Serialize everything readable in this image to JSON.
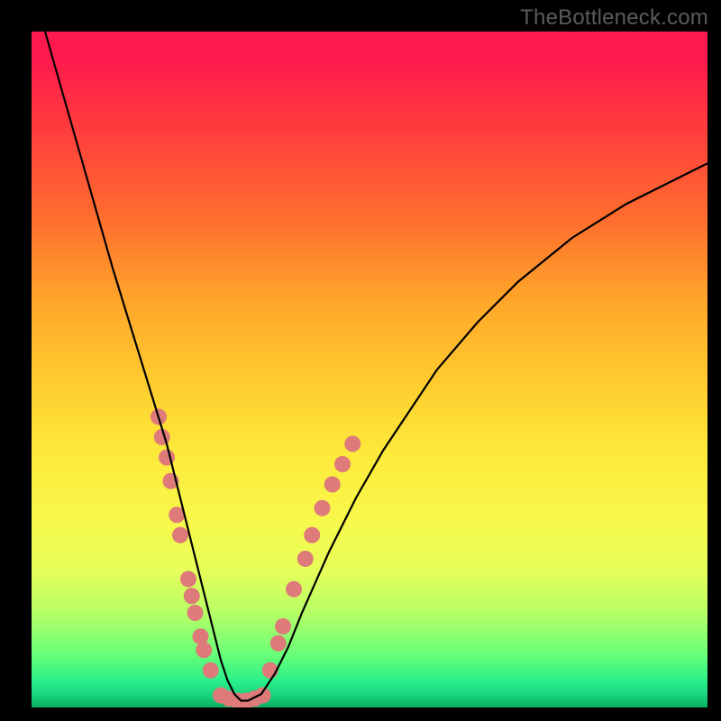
{
  "watermark": "TheBottleneck.com",
  "chart_data": {
    "type": "line",
    "title": "",
    "xlabel": "",
    "ylabel": "",
    "xlim": [
      0,
      100
    ],
    "ylim": [
      0,
      100
    ],
    "grid": false,
    "series": [
      {
        "name": "bottleneck-curve",
        "color": "#000000",
        "x": [
          2,
          4,
          6,
          8,
          10,
          12,
          14,
          16,
          18,
          20,
          21,
          22,
          23,
          24,
          25,
          26,
          27,
          28,
          29,
          30,
          31,
          32,
          34,
          36,
          38,
          40,
          44,
          48,
          52,
          56,
          60,
          66,
          72,
          80,
          88,
          96,
          100
        ],
        "y": [
          100,
          93,
          86,
          79,
          72,
          65,
          58.5,
          52,
          45.5,
          39,
          35,
          31,
          27,
          23,
          19,
          15,
          11,
          7,
          4,
          2,
          1,
          1,
          2,
          5,
          9,
          14,
          23,
          31,
          38,
          44,
          50,
          57,
          63,
          69.5,
          74.5,
          78.5,
          80.5
        ]
      }
    ],
    "markers": [
      {
        "name": "dots-left",
        "color": "#de7a7a",
        "radius": 9,
        "points": [
          {
            "x": 18.8,
            "y": 43
          },
          {
            "x": 19.3,
            "y": 40
          },
          {
            "x": 20.0,
            "y": 37
          },
          {
            "x": 20.6,
            "y": 33.5
          },
          {
            "x": 21.5,
            "y": 28.5
          },
          {
            "x": 22.0,
            "y": 25.5
          },
          {
            "x": 23.2,
            "y": 19
          },
          {
            "x": 23.7,
            "y": 16.5
          },
          {
            "x": 24.2,
            "y": 14
          },
          {
            "x": 25.0,
            "y": 10.5
          },
          {
            "x": 25.5,
            "y": 8.5
          },
          {
            "x": 26.5,
            "y": 5.5
          }
        ]
      },
      {
        "name": "dots-bottom",
        "color": "#de7a7a",
        "radius": 9,
        "points": [
          {
            "x": 28.0,
            "y": 1.8
          },
          {
            "x": 29.2,
            "y": 1.3
          },
          {
            "x": 30.5,
            "y": 1.0
          },
          {
            "x": 31.8,
            "y": 1.0
          },
          {
            "x": 33.0,
            "y": 1.3
          },
          {
            "x": 34.2,
            "y": 1.8
          }
        ]
      },
      {
        "name": "dots-right",
        "color": "#de7a7a",
        "radius": 9,
        "points": [
          {
            "x": 35.3,
            "y": 5.5
          },
          {
            "x": 36.5,
            "y": 9.5
          },
          {
            "x": 37.2,
            "y": 12
          },
          {
            "x": 38.8,
            "y": 17.5
          },
          {
            "x": 40.5,
            "y": 22
          },
          {
            "x": 41.5,
            "y": 25.5
          },
          {
            "x": 43.0,
            "y": 29.5
          },
          {
            "x": 44.5,
            "y": 33
          },
          {
            "x": 46.0,
            "y": 36
          },
          {
            "x": 47.5,
            "y": 39
          }
        ]
      }
    ],
    "background_gradient": {
      "top": "#ff1a4d",
      "upper_mid": "#ff6f2e",
      "mid": "#ffcc2e",
      "lower_mid": "#f8f84a",
      "bottom": "#09ad60"
    }
  }
}
